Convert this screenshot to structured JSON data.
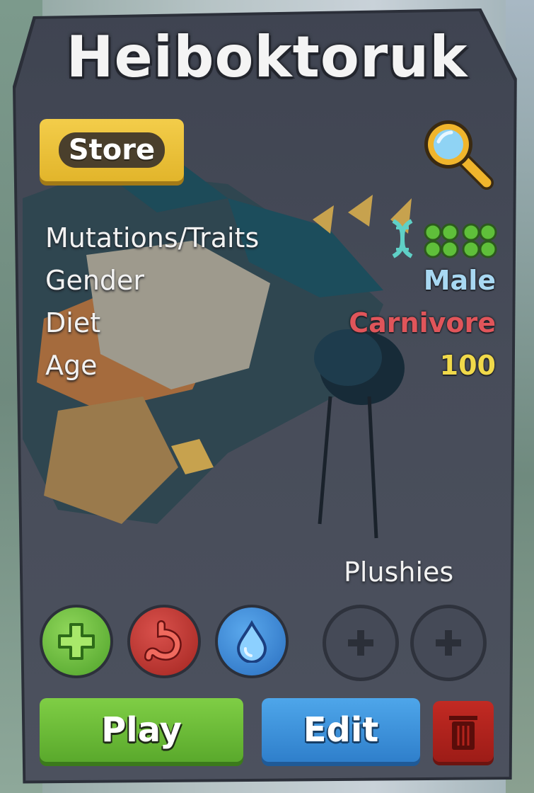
{
  "creature": {
    "name": "Heiboktoruk"
  },
  "store": {
    "label": "Store"
  },
  "stats": {
    "mutations_label": "Mutations/Traits",
    "gender_label": "Gender",
    "gender_value": "Male",
    "diet_label": "Diet",
    "diet_value": "Carnivore",
    "age_label": "Age",
    "age_value": "100"
  },
  "colors": {
    "gender": "#a8d8f2",
    "diet": "#e0555a",
    "age": "#f0d94a",
    "play": "#6fbf3a",
    "edit": "#3f93dc",
    "store": "#e8bf35",
    "trash": "#b2231c"
  },
  "icons": {
    "search": "search-icon",
    "dna": "dna-icon",
    "traits": [
      "trait-cluster-icon",
      "trait-cluster-icon"
    ],
    "heal": "plus-icon",
    "food": "stomach-icon",
    "water": "water-drop-icon",
    "trash": "trash-icon"
  },
  "plushies": {
    "label": "Plushies",
    "slots": [
      "empty",
      "empty"
    ]
  },
  "actions": {
    "play_label": "Play",
    "edit_label": "Edit"
  }
}
